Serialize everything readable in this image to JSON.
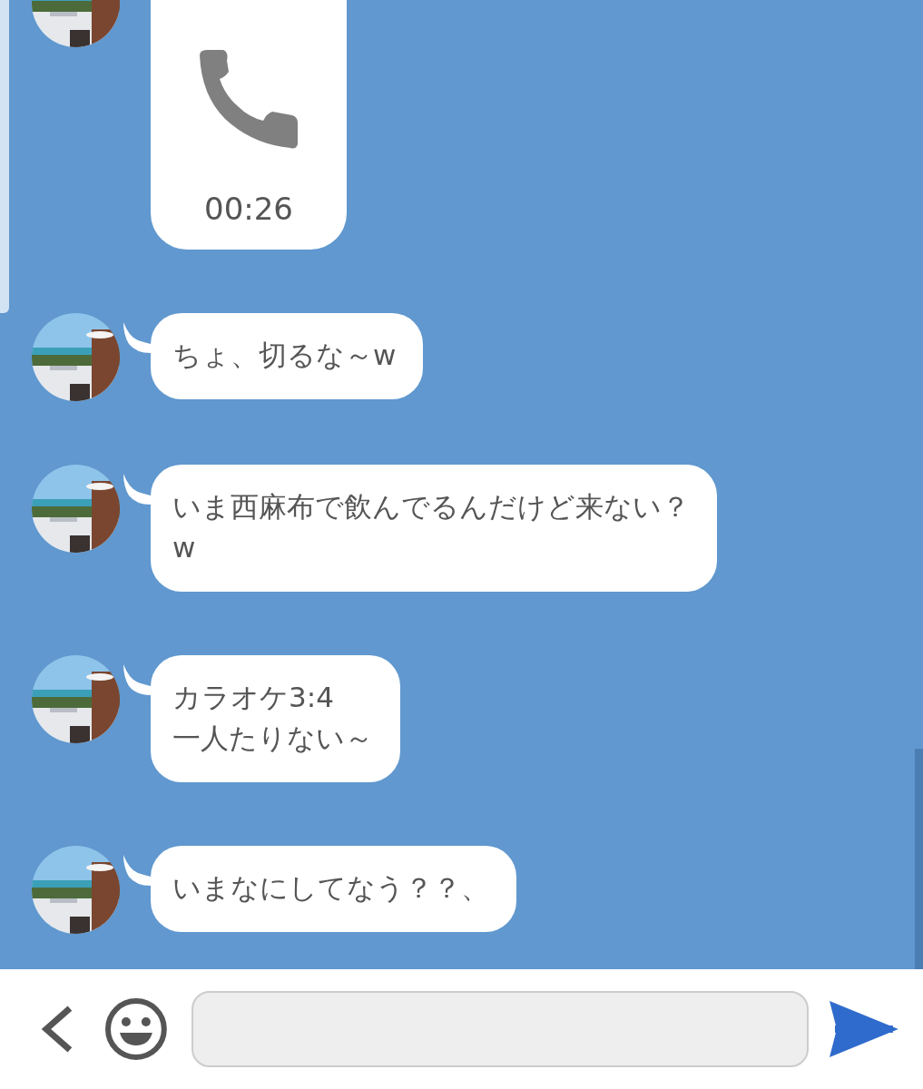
{
  "messages": [
    {
      "kind": "call",
      "duration": "00:26"
    },
    {
      "kind": "text",
      "text": "ちょ、切るな～w"
    },
    {
      "kind": "text",
      "text": "いま西麻布で飲んでるんだけど来ない？\nw"
    },
    {
      "kind": "text",
      "text": "カラオケ3:4\n一人たりない～"
    },
    {
      "kind": "text",
      "text": "いまなにしてなう？？、"
    }
  ]
}
